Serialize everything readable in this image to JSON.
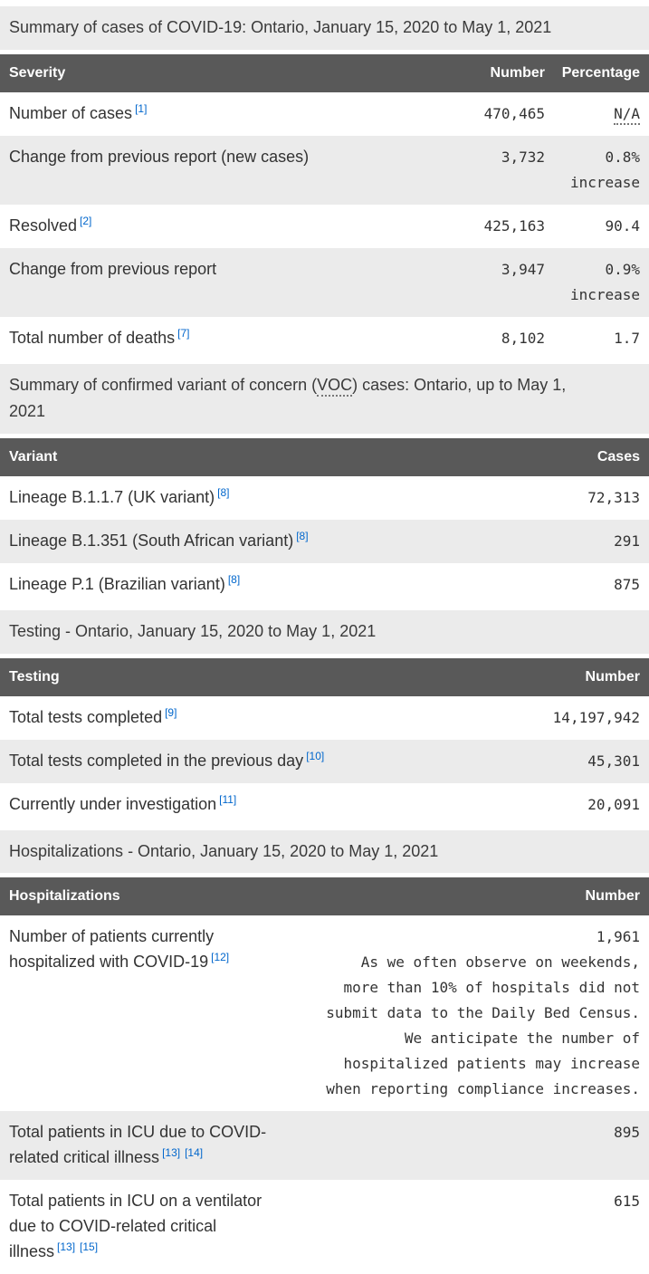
{
  "colors": {
    "header_bg": "#595959",
    "header_text": "#ffffff",
    "band_bg": "#ebebeb",
    "stripe_bg": "#ebebeb",
    "link_blue": "#0066cc",
    "body_text": "#333333"
  },
  "sections": [
    {
      "caption": "Summary of cases of COVID-19: Ontario, January 15, 2020 to May 1, 2021",
      "columns": [
        "Severity",
        "Number",
        "Percentage"
      ],
      "rows": [
        {
          "label": "Number of cases",
          "refs": [
            "[1]"
          ],
          "number": "470,465",
          "pct": "N/A"
        },
        {
          "label": "Change from previous report (new cases)",
          "refs": [],
          "number": "3,732",
          "pct": "0.8% increase"
        },
        {
          "label": "Resolved",
          "refs": [
            "[2]"
          ],
          "number": "425,163",
          "pct": "90.4"
        },
        {
          "label": "Change from previous report",
          "refs": [],
          "number": "3,947",
          "pct": "0.9% increase"
        },
        {
          "label": "Total number of deaths",
          "refs": [
            "[7]"
          ],
          "number": "8,102",
          "pct": "1.7"
        }
      ]
    },
    {
      "caption_pre": "Summary of confirmed variant of concern (",
      "caption_abbr": "VOC",
      "caption_post": ") cases: Ontario, up to May 1, 2021",
      "columns": [
        "Variant",
        "Cases"
      ],
      "rows": [
        {
          "label": "Lineage B.1.1.7 (UK variant)",
          "refs": [
            "[8]"
          ],
          "number": "72,313"
        },
        {
          "label": "Lineage B.1.351 (South African variant)",
          "refs": [
            "[8]"
          ],
          "number": "291"
        },
        {
          "label": "Lineage P.1 (Brazilian variant)",
          "refs": [
            "[8]"
          ],
          "number": "875"
        }
      ]
    },
    {
      "caption": "Testing - Ontario, January 15, 2020 to May 1, 2021",
      "columns": [
        "Testing",
        "Number"
      ],
      "rows": [
        {
          "label": "Total tests completed",
          "refs": [
            "[9]"
          ],
          "number": "14,197,942"
        },
        {
          "label": "Total tests completed in the previous day",
          "refs": [
            "[10]"
          ],
          "number": "45,301"
        },
        {
          "label": "Currently under investigation",
          "refs": [
            "[11]"
          ],
          "number": "20,091"
        }
      ]
    },
    {
      "caption": "Hospitalizations - Ontario, January 15, 2020 to May 1, 2021",
      "columns": [
        "Hospitalizations",
        "Number"
      ],
      "rows": [
        {
          "label": "Number of patients currently hospitalized with COVID-19",
          "refs": [
            "[12]"
          ],
          "number": "1,961",
          "note": "As we often observe on weekends, more than 10% of hospitals did not submit data to the Daily Bed Census. We anticipate the number of hospitalized patients may increase when reporting compliance increases."
        },
        {
          "label": "Total patients in ICU due to COVID-related critical illness",
          "refs": [
            "[13]",
            "[14]"
          ],
          "number": "895"
        },
        {
          "label": "Total patients in ICU on a ventilator due to COVID-related critical illness",
          "refs": [
            "[13]",
            "[15]"
          ],
          "number": "615"
        }
      ]
    }
  ]
}
